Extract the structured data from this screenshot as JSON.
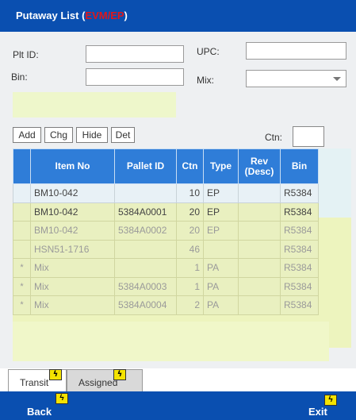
{
  "title": {
    "prefix": "Putaway List (",
    "mode": "EVM/EP",
    "suffix": ")"
  },
  "form": {
    "plt_id_label": "Plt ID:",
    "bin_label": "Bin:",
    "upc_label": "UPC:",
    "mix_label": "Mix:",
    "ctn_label": "Ctn:"
  },
  "toolbar": {
    "add": "Add",
    "chg": "Chg",
    "hide": "Hide",
    "det": "Det"
  },
  "grid": {
    "headers": {
      "item_no": "Item No",
      "pallet_id": "Pallet ID",
      "ctn": "Ctn",
      "type": "Type",
      "rev_1": "Rev",
      "rev_2": "(Desc)",
      "bin": "Bin"
    },
    "rows": [
      {
        "mark": "",
        "item": "BM10-042",
        "pallet": "",
        "ctn": "10",
        "type": "EP",
        "rev": "",
        "bin": "R5384"
      },
      {
        "mark": "",
        "item": "BM10-042",
        "pallet": "5384A0001",
        "ctn": "20",
        "type": "EP",
        "rev": "",
        "bin": "R5384"
      },
      {
        "mark": "",
        "item": "BM10-042",
        "pallet": "5384A0002",
        "ctn": "20",
        "type": "EP",
        "rev": "",
        "bin": "R5384"
      },
      {
        "mark": "",
        "item": "HSN51-1716",
        "pallet": "",
        "ctn": "46",
        "type": "",
        "rev": "",
        "bin": "R5384"
      },
      {
        "mark": "*",
        "item": "Mix",
        "pallet": "",
        "ctn": "1",
        "type": "PA",
        "rev": "",
        "bin": "R5384"
      },
      {
        "mark": "*",
        "item": "Mix",
        "pallet": "5384A0003",
        "ctn": "1",
        "type": "PA",
        "rev": "",
        "bin": "R5384"
      },
      {
        "mark": "*",
        "item": "Mix",
        "pallet": "5384A0004",
        "ctn": "2",
        "type": "PA",
        "rev": "",
        "bin": "R5384"
      }
    ]
  },
  "tabs": {
    "transit": "Transit",
    "assigned": "Assigned"
  },
  "footer": {
    "back": "Back",
    "exit": "Exit"
  },
  "colors": {
    "header_blue": "#0a4fb0",
    "grid_header": "#2f7dd8",
    "mode_red": "#e0161a",
    "hotkey_yellow": "#f4e300"
  }
}
